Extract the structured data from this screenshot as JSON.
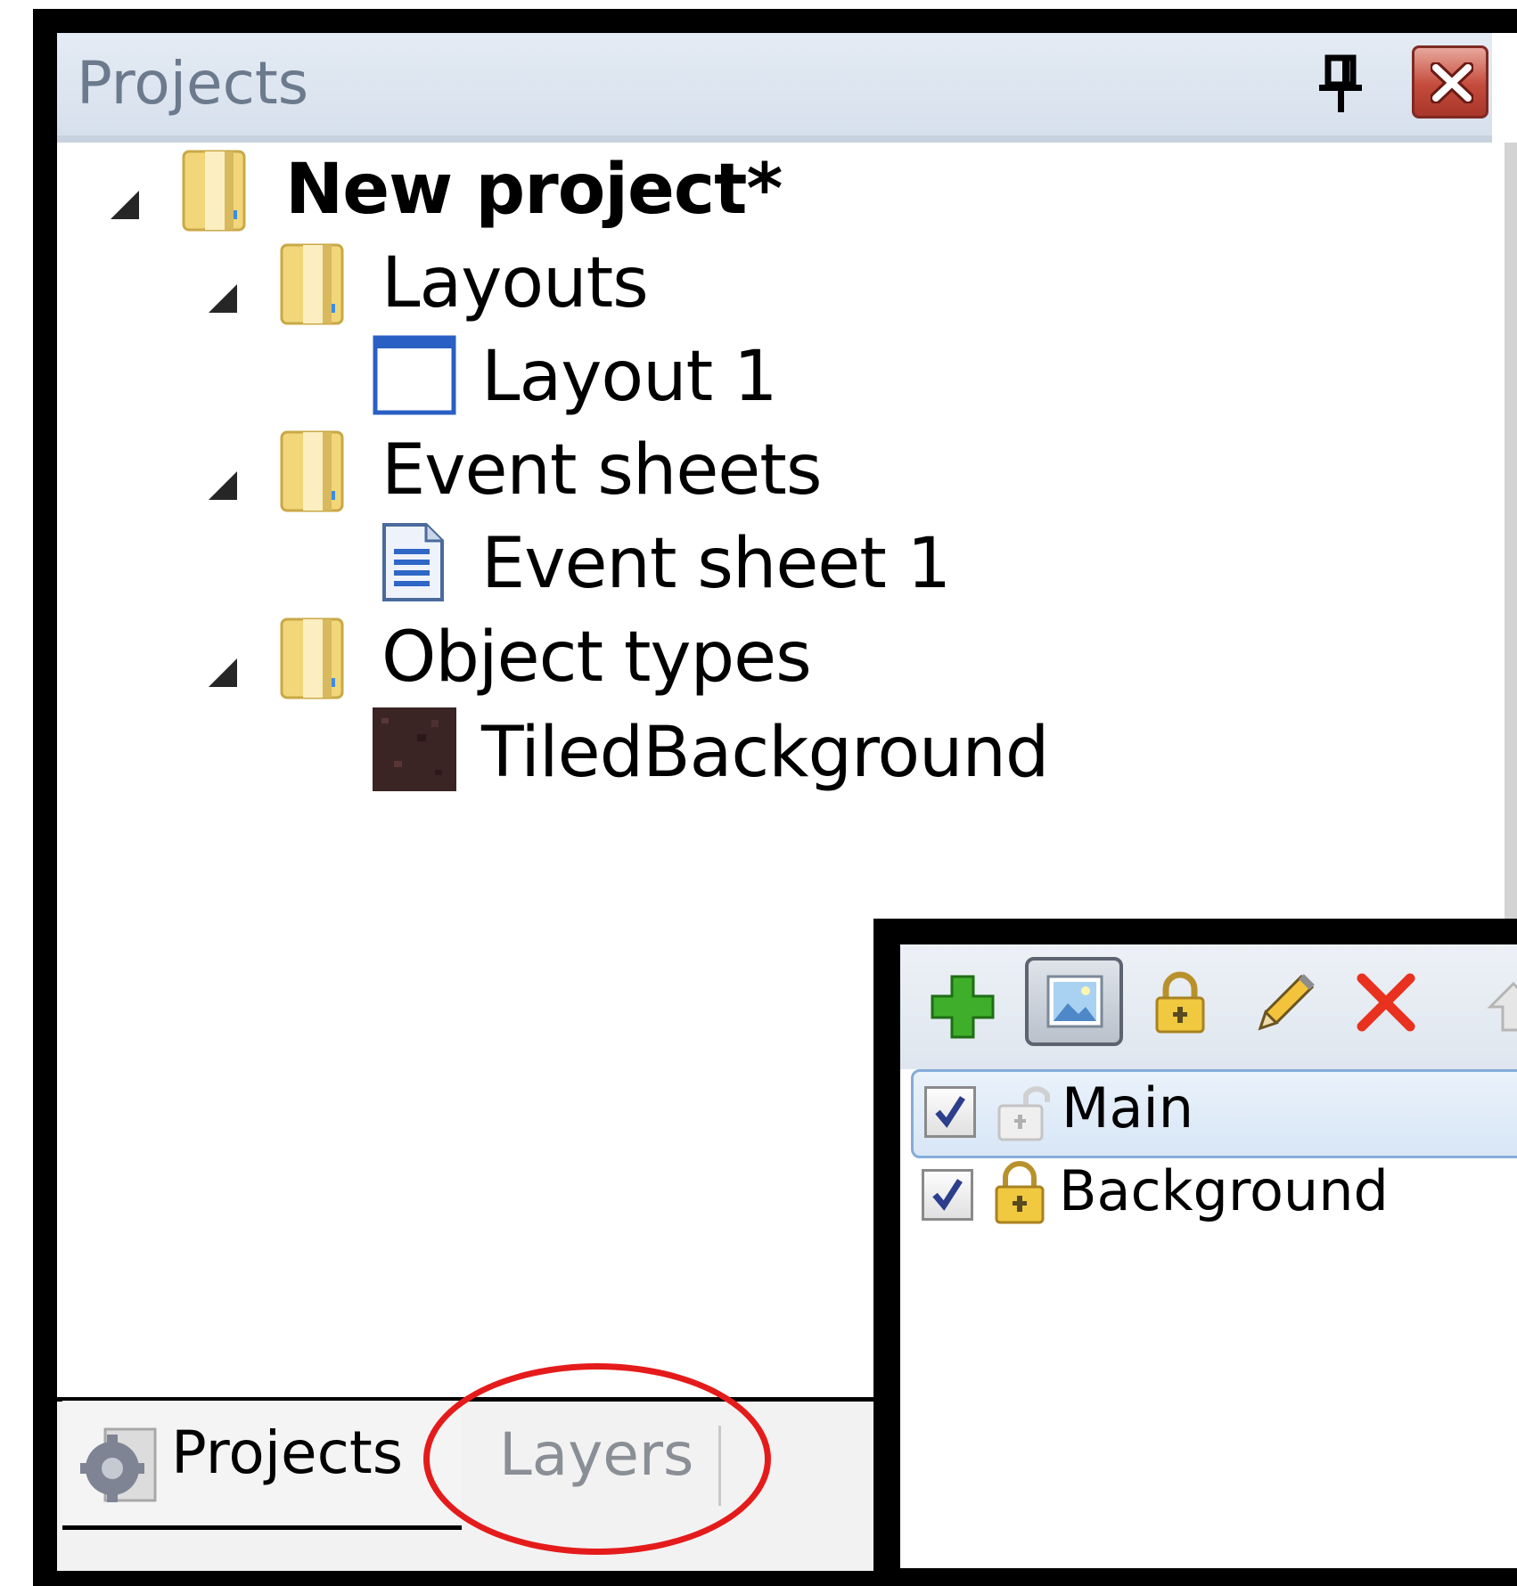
{
  "window": {
    "title": "Projects"
  },
  "tree": {
    "root": {
      "label": "New project*",
      "icon": "folder-icon"
    },
    "items": [
      {
        "label": "Layouts",
        "icon": "folder-icon"
      },
      {
        "label": "Layout 1",
        "icon": "layout-icon"
      },
      {
        "label": "Event sheets",
        "icon": "folder-icon"
      },
      {
        "label": "Event sheet 1",
        "icon": "event-sheet-icon"
      },
      {
        "label": "Object types",
        "icon": "folder-icon"
      },
      {
        "label": "TiledBackground",
        "icon": "tiled-background-thumbnail"
      }
    ]
  },
  "tabs": [
    {
      "label": "Projects",
      "icon": "gear-icon",
      "active": true
    },
    {
      "label": "Layers",
      "active": false
    }
  ],
  "layers": {
    "toolbar": [
      "add-layer-icon",
      "layer-image-icon",
      "lock-icon",
      "pencil-icon",
      "delete-icon"
    ],
    "rows": [
      {
        "label": "Main",
        "checked": true,
        "locked": false,
        "selected": true
      },
      {
        "label": "Background",
        "checked": true,
        "locked": true,
        "selected": false
      }
    ]
  },
  "colors": {
    "highlight_circle": "#e51b1b",
    "close_button": "#c44b3c",
    "selected_row": "#d8e6f6"
  }
}
